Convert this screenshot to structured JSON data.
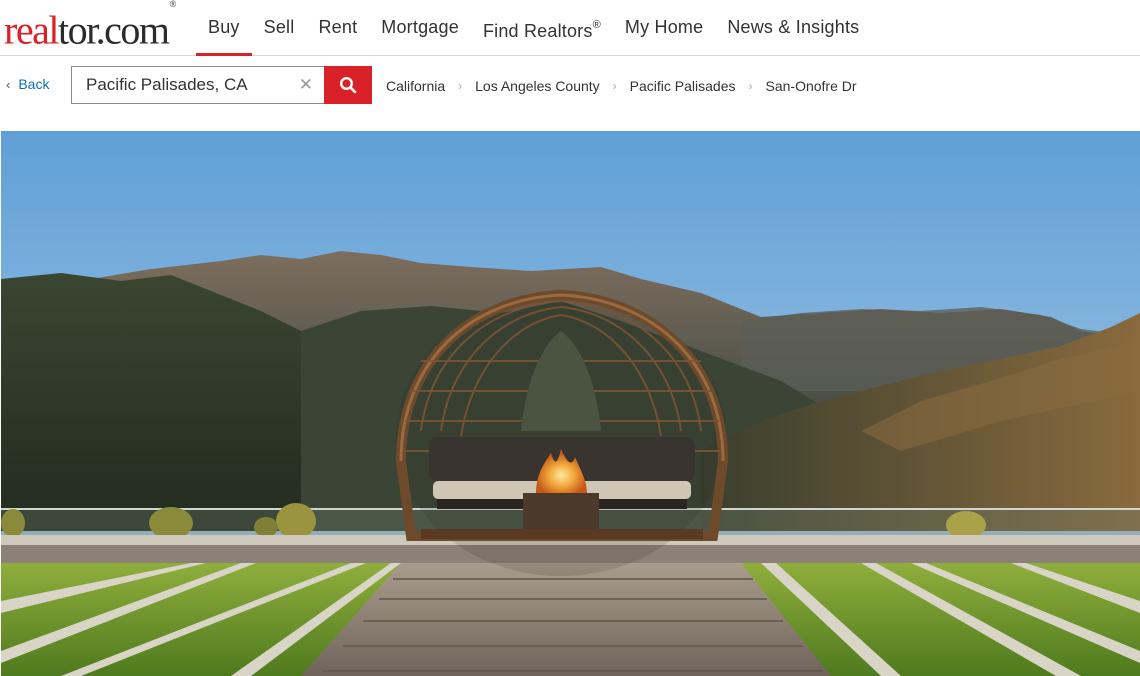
{
  "logo": {
    "part1": "real",
    "part2": "tor.com",
    "mark": "®"
  },
  "nav": {
    "items": [
      {
        "label": "Buy",
        "sup": "",
        "active": true
      },
      {
        "label": "Sell",
        "sup": ""
      },
      {
        "label": "Rent",
        "sup": ""
      },
      {
        "label": "Mortgage",
        "sup": ""
      },
      {
        "label": "Find Realtors",
        "sup": "®"
      },
      {
        "label": "My Home",
        "sup": ""
      },
      {
        "label": "News & Insights",
        "sup": ""
      }
    ]
  },
  "search": {
    "back_label": "Back",
    "value": "Pacific Palisades, CA",
    "clear_icon": "close-icon",
    "button_icon": "search-icon"
  },
  "breadcrumb": {
    "items": [
      "California",
      "Los Angeles County",
      "Pacific Palisades",
      "San-Onofre Dr"
    ]
  },
  "colors": {
    "brand_red": "#d92228",
    "link_blue": "#0a6ebd"
  }
}
